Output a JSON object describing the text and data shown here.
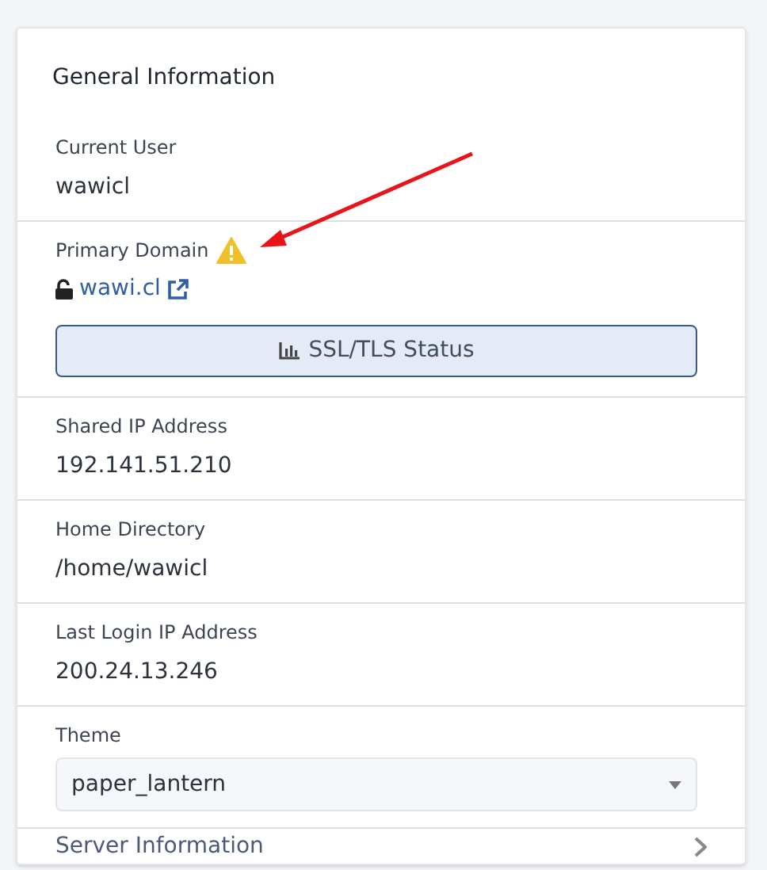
{
  "panel": {
    "title": "General Information",
    "rows": [
      {
        "kind": "text",
        "label": "Current User",
        "value": "wawicl"
      },
      {
        "kind": "domain",
        "label": "Primary Domain",
        "warning": true,
        "value": "wawi.cl",
        "button": "SSL/TLS Status"
      },
      {
        "kind": "text",
        "label": "Shared IP Address",
        "value": "192.141.51.210"
      },
      {
        "kind": "text",
        "label": "Home Directory",
        "value": "/home/wawicl"
      },
      {
        "kind": "text",
        "label": "Last Login IP Address",
        "value": "200.24.13.246"
      },
      {
        "kind": "select",
        "label": "Theme",
        "value": "paper_lantern"
      }
    ],
    "footer": {
      "label": "Server Information",
      "expanded": false
    }
  },
  "annotation": {
    "kind": "arrow"
  }
}
